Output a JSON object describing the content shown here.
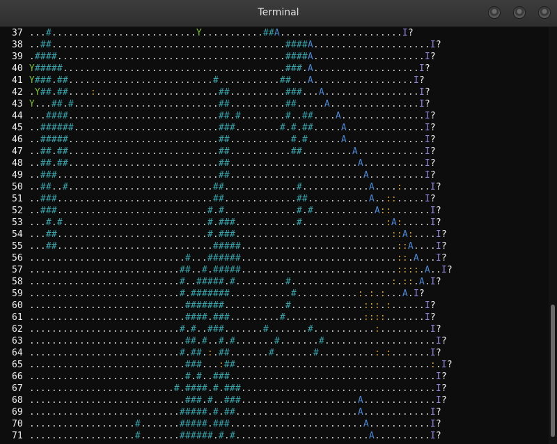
{
  "window": {
    "title": "Terminal"
  },
  "terminal": {
    "lines": [
      {
        "num": "37",
        "text": "...#..........................Y...........##A......................I?"
      },
      {
        "num": "38",
        "text": "..##..........................................####A.....................I?"
      },
      {
        "num": "39",
        "text": ".####.........................................####A....................I?"
      },
      {
        "num": "40",
        "text": "Y#####........................................###.A...................I?"
      },
      {
        "num": "41",
        "text": "Y###.##..........................#...........##...A..................I?"
      },
      {
        "num": "42",
        "text": ".Y##.##....:......................##..........###...A.................I?"
      },
      {
        "num": "43",
        "text": "Y...##.#..........................##..........##.....A................I?"
      },
      {
        "num": "44",
        "text": "...####...........................##.#........#..##....A...............I?"
      },
      {
        "num": "45",
        "text": "..######..........................###........#.#.##.....A..............I?"
      },
      {
        "num": "46",
        "text": "..#####...........................##...........#.#......A..............I?"
      },
      {
        "num": "47",
        "text": "..##.##...........................##...........##.........A............I?"
      },
      {
        "num": "48",
        "text": "..##.##...........................##.......................A...........I?"
      },
      {
        "num": "49",
        "text": "..###.............................##........................A..........I?"
      },
      {
        "num": "50",
        "text": "..##..#..........................##.............#............A....:.....I?"
      },
      {
        "num": "51",
        "text": "..###............................##.............##...........A..::.....I?"
      },
      {
        "num": "52",
        "text": "..###...........................#.#.............#.#...........A::.......I?"
      },
      {
        "num": "53",
        "text": "...#.#..........................#.###...........#...............:A:.....I?"
      },
      {
        "num": "54",
        "text": "...##...........................#.###............................::A:....I?"
      },
      {
        "num": "55",
        "text": "...##............................#####............................::A....I?"
      },
      {
        "num": "56",
        "text": "............................#...######............................::.A...I?"
      },
      {
        "num": "57",
        "text": "...........................##..#.#####............................::::.A..I?"
      },
      {
        "num": "58",
        "text": "...........................#..#####.#.........#..................:.::.A.I?"
      },
      {
        "num": "59",
        "text": "...........................#.#######...........#...........:.:.:...A.I?"
      },
      {
        "num": "60",
        "text": "............................#######...........#.............:::.:......I?"
      },
      {
        "num": "61",
        "text": "............................####.###.........#..............::::.......I?"
      },
      {
        "num": "62",
        "text": "...........................#.#..###.......#.......#...........:.........I?"
      },
      {
        "num": "63",
        "text": "............................##.#..#.#.......#.......#....................I?"
      },
      {
        "num": "64",
        "text": "...........................#.##.:.##.......#.......#..........:.:.......I?"
      },
      {
        "num": "65",
        "text": "............................###...:##...................................:.I?"
      },
      {
        "num": "66",
        "text": "............................#.#..###.....................................I?"
      },
      {
        "num": "67",
        "text": "..........................#.####.#.###...................................I?"
      },
      {
        "num": "68",
        "text": "............................###.#..###.....................A.............I?"
      },
      {
        "num": "69",
        "text": "...........................#####.#.##......................A............I?"
      },
      {
        "num": "70",
        "text": "...................#.......#####.###........................A...........I?"
      },
      {
        "num": "71",
        "text": "...................#.......######.#.#........................A..........I?"
      }
    ]
  },
  "colors": {
    "background": "#0d0d0d",
    "dot": "#cfcfcf",
    "hash": "#3aa3ab",
    "agent": "#4d86d1",
    "yellow_marker": "#7fbf3b",
    "colon": "#d8a52a",
    "I_marker": "#8e86d8"
  }
}
